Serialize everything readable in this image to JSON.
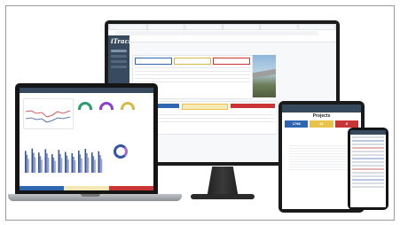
{
  "colors": {
    "sidebar": "#374a5e",
    "blue": "#2f66b2",
    "yellow": "#e8c24a",
    "red": "#c93434",
    "green": "#2b9b6a",
    "purple": "#8a3fd1"
  },
  "imac": {
    "app_logo": "iTrack",
    "tabs": [
      "",
      "",
      "",
      "",
      "",
      ""
    ],
    "header_title": "",
    "breadcrumb": "",
    "panel_label": "",
    "status": [
      "",
      "",
      ""
    ]
  },
  "laptop": {
    "bar_heights_fraction": [
      0.65,
      0.72,
      0.6,
      0.7,
      0.55,
      0.68,
      0.62,
      0.58,
      0.66,
      0.71,
      0.6,
      0.64
    ],
    "bar_colors": [
      "#3355a1",
      "#6f80b8",
      "#9aa4c9"
    ]
  },
  "tablet": {
    "title": "",
    "projects_label": "Projects",
    "stats": [
      {
        "value": "1798",
        "color": "#2f66b2"
      },
      {
        "value": "22",
        "color": "#e8c24a"
      },
      {
        "value": "8",
        "color": "#c93434"
      }
    ],
    "rows": [
      {
        "name": "",
        "value": ""
      },
      {
        "name": "",
        "value": ""
      },
      {
        "name": "",
        "value": ""
      },
      {
        "name": "",
        "value": ""
      },
      {
        "name": "",
        "value": ""
      },
      {
        "name": "",
        "value": ""
      },
      {
        "name": "",
        "value": ""
      },
      {
        "name": "",
        "value": ""
      },
      {
        "name": "",
        "value": ""
      },
      {
        "name": "",
        "value": ""
      }
    ]
  }
}
